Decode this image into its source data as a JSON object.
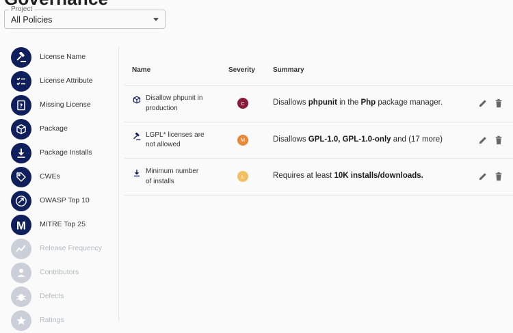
{
  "page": {
    "title": "Governance"
  },
  "project": {
    "legend": "Project",
    "value": "All Policies"
  },
  "sidebar": {
    "items": [
      {
        "label": "License Name",
        "icon": "gavel-icon",
        "enabled": true
      },
      {
        "label": "License Attribute",
        "icon": "checklist-icon",
        "enabled": true
      },
      {
        "label": "Missing License",
        "icon": "question-document-icon",
        "enabled": true
      },
      {
        "label": "Package",
        "icon": "package-icon",
        "enabled": true
      },
      {
        "label": "Package Installs",
        "icon": "download-icon",
        "enabled": true
      },
      {
        "label": "CWEs",
        "icon": "tags-icon",
        "enabled": true
      },
      {
        "label": "OWASP Top 10",
        "icon": "owasp-icon",
        "enabled": true
      },
      {
        "label": "MITRE Top 25",
        "icon": "mitre-icon",
        "enabled": true
      },
      {
        "label": "Release Frequency",
        "icon": "trend-icon",
        "enabled": false
      },
      {
        "label": "Contributors",
        "icon": "person-icon",
        "enabled": false
      },
      {
        "label": "Defects",
        "icon": "bug-icon",
        "enabled": false
      },
      {
        "label": "Ratings",
        "icon": "star-icon",
        "enabled": false
      }
    ]
  },
  "table": {
    "headers": {
      "name": "Name",
      "severity": "Severity",
      "summary": "Summary"
    },
    "rows": [
      {
        "icon": "package-icon",
        "name_line1": "Disallow phpunit in",
        "name_line2": "production",
        "severity": "C",
        "severity_color": "#8b1a3a",
        "summary": {
          "t1": "Disallows ",
          "b1": "phpunit",
          "t2": " in the ",
          "b2": "Php",
          "t3": " package manager."
        }
      },
      {
        "icon": "gavel-icon",
        "name_line1": "LGPL* licenses are",
        "name_line2": "not allowed",
        "severity": "M",
        "severity_color": "#e8893a",
        "summary": {
          "t1": "Disallows ",
          "b1": "GPL-1.0, GPL-1.0-only",
          "t2": " and (17 more)",
          "b2": "",
          "t3": ""
        }
      },
      {
        "icon": "download-icon",
        "name_line1": "Minimum number",
        "name_line2": "of installs",
        "severity": "L",
        "severity_color": "#f2c063",
        "summary": {
          "t1": "Requires at least ",
          "b1": "10K installs/downloads.",
          "t2": "",
          "b2": "",
          "t3": ""
        }
      }
    ]
  },
  "actions": {
    "edit_icon": "pencil-icon",
    "delete_icon": "trash-icon"
  },
  "colors": {
    "primary": "#0f1f5c",
    "disabled": "#cbcfd9",
    "critical": "#8b1a3a",
    "medium": "#e8893a",
    "low": "#f2c063"
  }
}
